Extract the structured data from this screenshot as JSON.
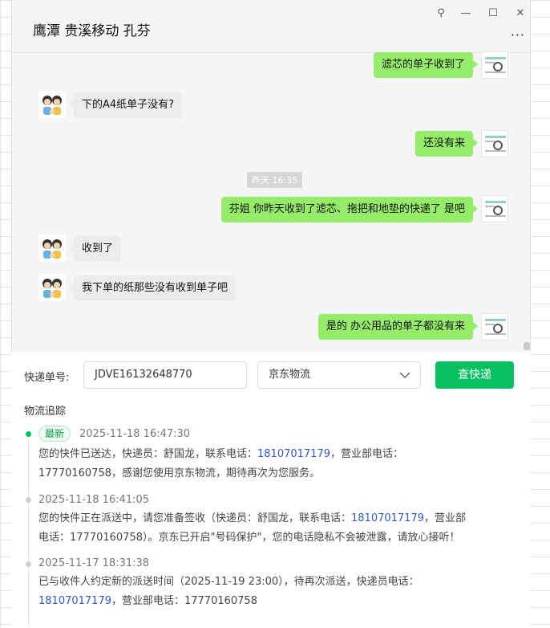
{
  "chat": {
    "title": "鹰潭 贵溪移动 孔芬",
    "controls": {
      "pin": "⚲",
      "minimize": "—",
      "maximize": "☐",
      "close": "✕",
      "more": "···"
    },
    "messages": [
      {
        "side": "me",
        "text": "滤芯的单子收到了"
      },
      {
        "side": "other",
        "text": "下的A4纸单子没有?"
      },
      {
        "side": "me",
        "text": "还没有来"
      },
      {
        "side": "me",
        "text": "芬姐 你昨天收到了滤芯、拖把和地垫的快递了 是吧"
      },
      {
        "side": "other",
        "text": "收到了"
      },
      {
        "side": "other",
        "text": "我下单的纸那些没有收到单子吧"
      },
      {
        "side": "me",
        "text": "是的  办公用品的单子都没有来"
      }
    ],
    "timestamp": "昨天 16:35"
  },
  "tracking": {
    "label": "快递单号:",
    "tracking_number": "JDVE16132648770",
    "carrier": "京东物流",
    "query_button": "查快递",
    "section_title": "物流追踪",
    "latest_badge": "最新",
    "accent_color": "#07c160",
    "events": [
      {
        "time": "2025-11-18 16:47:30",
        "line1_a": "您的快件已送达，快递员：舒国龙，联系电话：",
        "line1_phone": "18107017179",
        "line1_b": "，营业部电话：",
        "line2": "17770160758，感谢您使用京东物流，期待再次为您服务。"
      },
      {
        "time": "2025-11-18 16:41:05",
        "line1_a": "您的快件正在派送中，请您准备签收（快递员：舒国龙，联系电话：",
        "line1_phone": "18107017179",
        "line1_b": "，营业部",
        "line2": "电话：17770160758）。京东已开启\"号码保护\"，您的电话隐私不会被泄露，请放心接听！"
      },
      {
        "time": "2025-11-17 18:31:38",
        "line1_a": "已与收件人约定新的派送时间（2025-11-19 23:00），待再次派送，快递员电话：",
        "line2_phone": "18107017179",
        "line2_b": "，营业部电话：17770160758"
      }
    ]
  }
}
